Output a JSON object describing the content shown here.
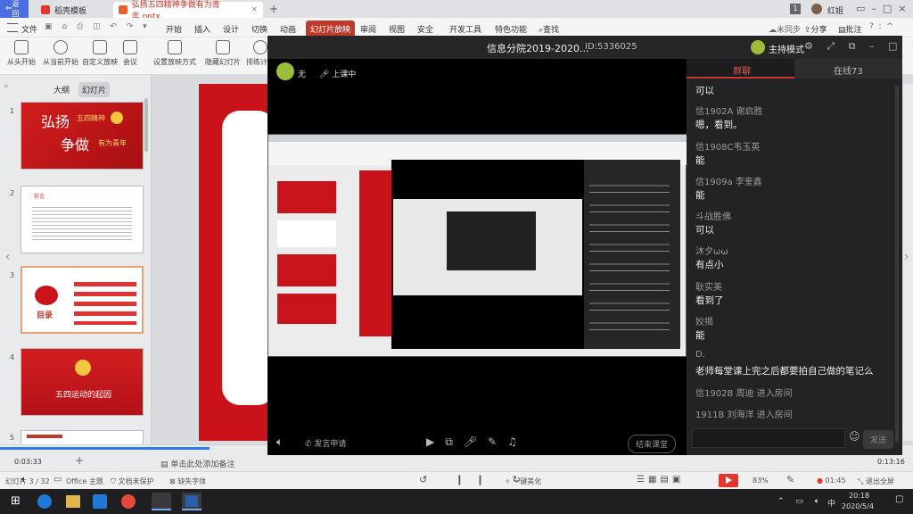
{
  "tabs": {
    "back": "返回",
    "tab1": "稻壳模板",
    "tab2": "弘扬五四精神争做有为青年.pptx",
    "new_tab": "+",
    "badge": "1",
    "user": "红姐"
  },
  "menubar": {
    "file": "文件",
    "items": [
      "开始",
      "插入",
      "设计",
      "切换",
      "动画",
      "幻灯片放映",
      "审阅",
      "视图",
      "安全",
      "开发工具",
      "特色功能"
    ],
    "search": "查找",
    "unsync": "未同步",
    "share": "分享",
    "comment": "批注"
  },
  "toolbar": [
    "从头开始",
    "从当前开始",
    "自定义放映",
    "会议",
    "设置放映方式",
    "隐藏幻灯片",
    "排练计时"
  ],
  "leftpane": {
    "tab_outline": "大纲",
    "tab_slides": "幻灯片",
    "slide_nums": [
      "1",
      "2",
      "3",
      "4",
      "5"
    ],
    "slide1_title": "弘扬",
    "slide1_sub": "五四精神",
    "slide1_line": "争做",
    "slide1_line2": "有为青年",
    "slide2_head": "前言",
    "slide3_label": "目录",
    "slide4_title": "五四运动的起因",
    "add_note": "单击此处添加备注"
  },
  "overlay": {
    "title": "信息分院2019-2020...",
    "id": "ID:5336025",
    "host_mode": "主持模式",
    "user_label": "无",
    "class_status": "上课中",
    "apply_speak": "发言申请",
    "end_class": "结束课堂",
    "chat_tab": "群聊",
    "online_tab": "在线73",
    "send": "发送",
    "messages": [
      {
        "name": "",
        "text": "可以"
      },
      {
        "name": "信1902A  谢启胜",
        "text": "嗯，看到。"
      },
      {
        "name": "信1908C韦玉英",
        "text": "能"
      },
      {
        "name": "信1909a 李奎鑫",
        "text": "能"
      },
      {
        "name": "斗战胜佛",
        "text": "可以"
      },
      {
        "name": "沐夕ωω",
        "text": "有点小"
      },
      {
        "name": "耿实美",
        "text": "看到了"
      },
      {
        "name": "姣揭",
        "text": "能"
      },
      {
        "name": "D.",
        "text": "老师每堂课上完之后都要拍自己做的笔记么"
      }
    ],
    "joins": [
      "信1902B    周迪 进入房间",
      "1911B 刘海洋 进入房间"
    ]
  },
  "timeline": {
    "left": "0:03:33",
    "right": "0:13:16"
  },
  "statusbar": {
    "slide_info": "幻灯片 3 / 32",
    "theme": "Office 主题",
    "protect": "文档未保护",
    "missing_font": "缺失字体",
    "beautify": "一键美化",
    "zoom": "83%",
    "time1": "01:45",
    "exit_play": "退出全屏"
  },
  "taskbar": {
    "time": "20:18",
    "date": "2020/5/4",
    "ime": "中"
  },
  "colors": {
    "accent": "#c0392b",
    "wps_red": "#e5362c",
    "dark": "#1f1f22",
    "chat_bg": "#232325"
  }
}
